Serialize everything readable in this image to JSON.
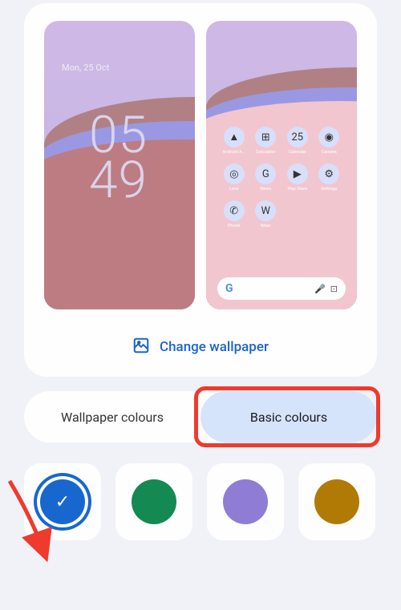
{
  "preview": {
    "lock_date": "Mon, 25 Oct",
    "lock_time_top": "05",
    "lock_time_bottom": "49",
    "apps": [
      {
        "label": "Android A...",
        "glyph": "▲"
      },
      {
        "label": "Calculator",
        "glyph": "⊞"
      },
      {
        "label": "Calendar",
        "glyph": "25"
      },
      {
        "label": "Camera",
        "glyph": "◉"
      },
      {
        "label": "Lens",
        "glyph": "◎"
      },
      {
        "label": "News",
        "glyph": "G"
      },
      {
        "label": "Play Store",
        "glyph": "▶"
      },
      {
        "label": "Settings",
        "glyph": "⚙"
      },
      {
        "label": "Phone",
        "glyph": "✆"
      },
      {
        "label": "Wear",
        "glyph": "W"
      },
      {
        "label": "",
        "glyph": ""
      },
      {
        "label": "",
        "glyph": ""
      }
    ],
    "search_letter": "G"
  },
  "change_wallpaper_label": "Change wallpaper",
  "tabs": {
    "wallpaper": "Wallpaper colours",
    "basic": "Basic colours"
  },
  "swatches": [
    {
      "color": "#1767cf",
      "selected": true
    },
    {
      "color": "#148a52",
      "selected": false
    },
    {
      "color": "#8e7cd5",
      "selected": false
    },
    {
      "color": "#b07a05",
      "selected": false
    }
  ],
  "annotation": {
    "arrow_color": "#ef3a2e"
  }
}
